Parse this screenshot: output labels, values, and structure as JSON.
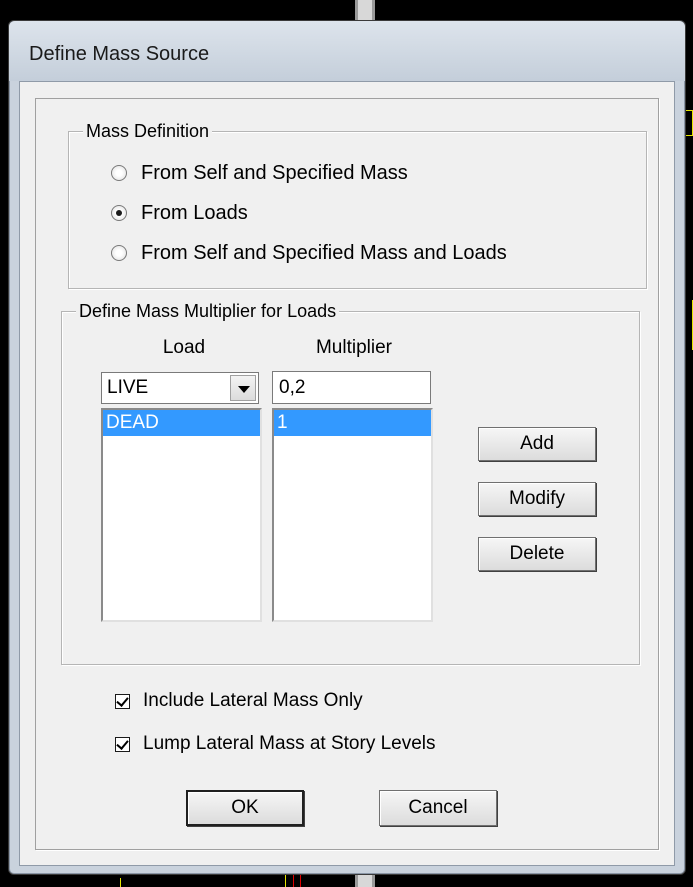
{
  "window": {
    "title": "Define Mass Source"
  },
  "mass_definition": {
    "legend": "Mass Definition",
    "options": [
      {
        "label": "From Self and Specified Mass",
        "checked": false
      },
      {
        "label": "From Loads",
        "checked": true
      },
      {
        "label": "From Self and Specified Mass and Loads",
        "checked": false
      }
    ]
  },
  "multiplier": {
    "legend": "Define Mass Multiplier for Loads",
    "load_header": "Load",
    "multiplier_header": "Multiplier",
    "load_selected": "LIVE",
    "multiplier_value": "0,2",
    "load_list": [
      {
        "label": "DEAD",
        "selected": true
      }
    ],
    "multiplier_list": [
      {
        "label": "1",
        "selected": true
      }
    ],
    "buttons": {
      "add": "Add",
      "modify": "Modify",
      "delete": "Delete"
    }
  },
  "options": {
    "include_lateral": {
      "label": "Include Lateral Mass Only",
      "checked": true
    },
    "lump_lateral": {
      "label": "Lump Lateral Mass at Story Levels",
      "checked": true
    }
  },
  "footer": {
    "ok": "OK",
    "cancel": "Cancel"
  },
  "colors": {
    "selection": "#3399ff",
    "dialog_bg": "#f0f0f0",
    "titlebar": "#c9d2dd"
  }
}
